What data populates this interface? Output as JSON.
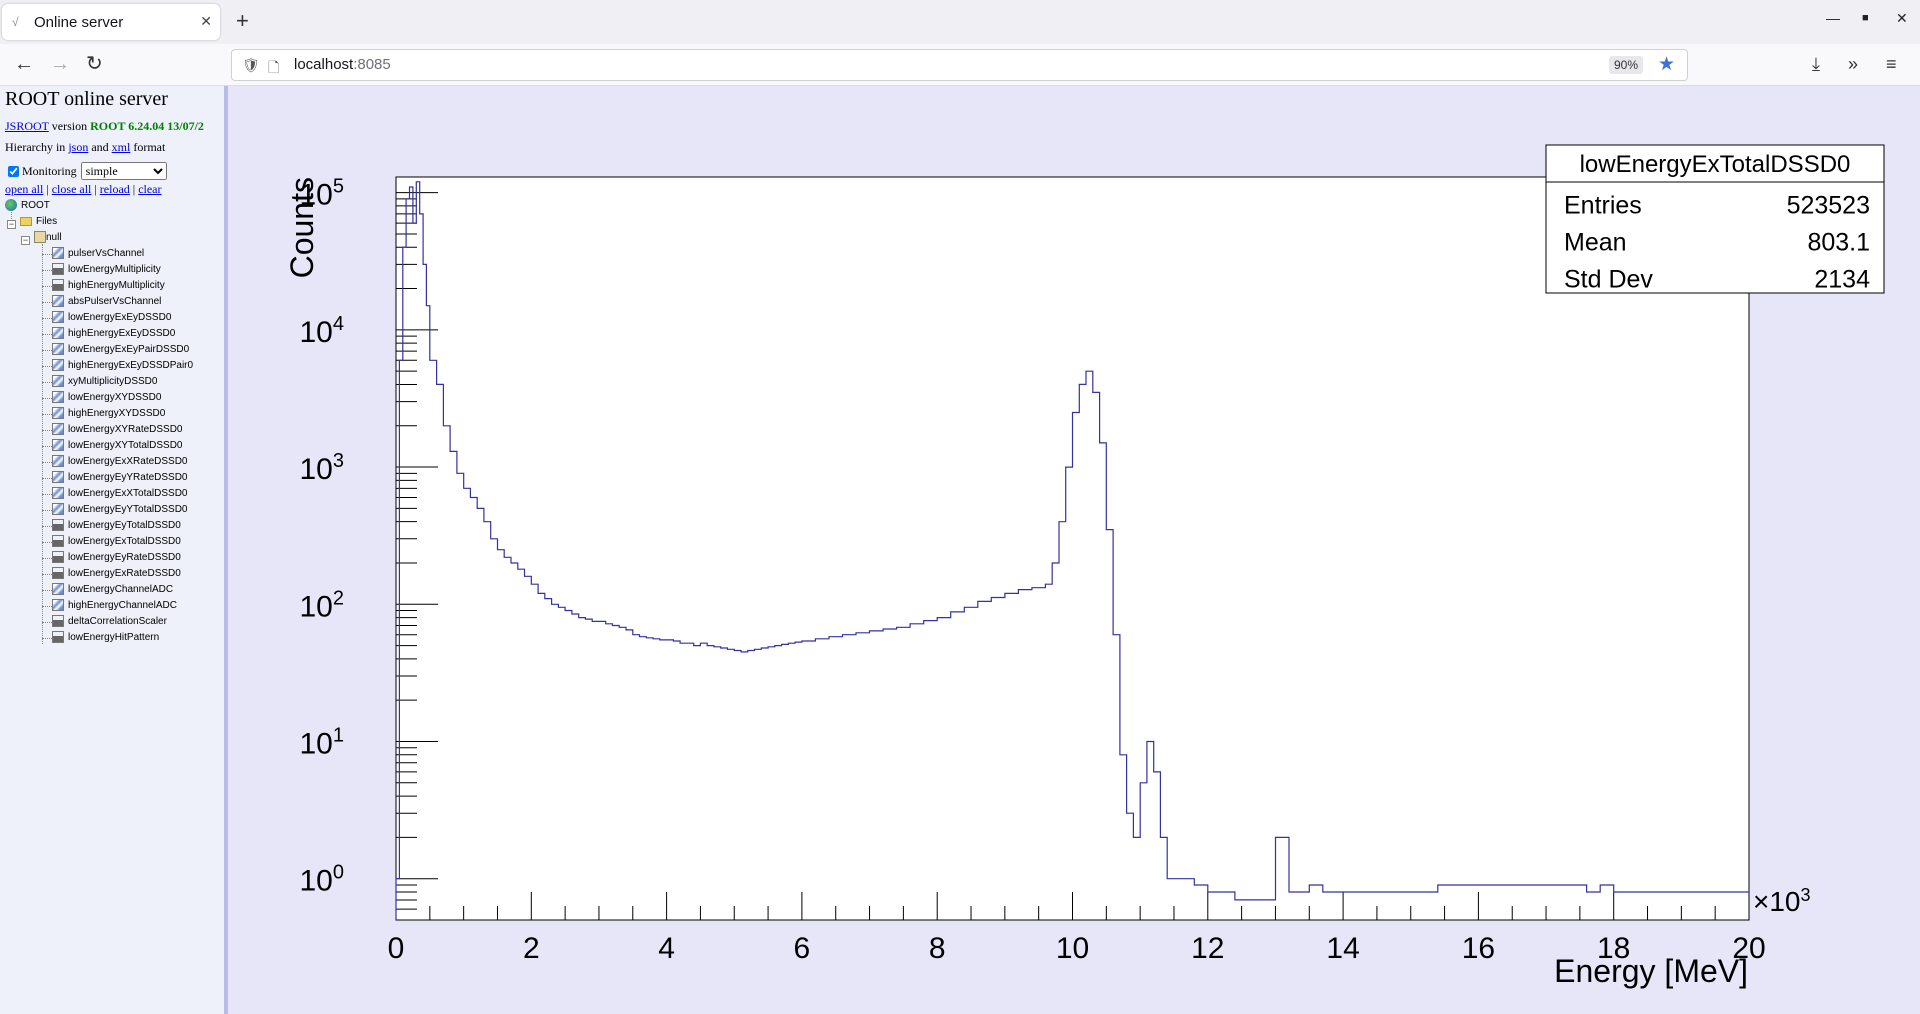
{
  "browser": {
    "tab_title": "Online server",
    "url_host": "localhost",
    "url_port": ":8085",
    "zoom": "90%"
  },
  "sidebar": {
    "title": "ROOT online server",
    "jsroot_link": "JSROOT",
    "version_word": "version",
    "version_value": "ROOT 6.24.04 13/07/2",
    "hierarchy_prefix": "Hierarchy in",
    "json_link": "json",
    "and_word": "and",
    "xml_link": "xml",
    "format_word": "format",
    "monitoring_label": "Monitoring",
    "monitoring_checked": true,
    "monitoring_mode": "simple",
    "actions": [
      "open all",
      "close all",
      "reload",
      "clear"
    ],
    "tree": {
      "root": "ROOT",
      "files": "Files",
      "null": "null",
      "items": [
        {
          "label": "pulserVsChannel",
          "icon": "h2-icon"
        },
        {
          "label": "lowEnergyMultiplicity",
          "icon": "h1-icon"
        },
        {
          "label": "highEnergyMultiplicity",
          "icon": "h1-icon"
        },
        {
          "label": "absPulserVsChannel",
          "icon": "h2-icon"
        },
        {
          "label": "lowEnergyExEyDSSD0",
          "icon": "h2-icon"
        },
        {
          "label": "highEnergyExEyDSSD0",
          "icon": "h2-icon"
        },
        {
          "label": "lowEnergyExEyPairDSSD0",
          "icon": "h2-icon"
        },
        {
          "label": "highEnergyExEyDSSDPair0",
          "icon": "h2-icon"
        },
        {
          "label": "xyMultiplicityDSSD0",
          "icon": "h2-icon"
        },
        {
          "label": "lowEnergyXYDSSD0",
          "icon": "h2-icon"
        },
        {
          "label": "highEnergyXYDSSD0",
          "icon": "h2-icon"
        },
        {
          "label": "lowEnergyXYRateDSSD0",
          "icon": "h2-icon"
        },
        {
          "label": "lowEnergyXYTotalDSSD0",
          "icon": "h2-icon"
        },
        {
          "label": "lowEnergyExXRateDSSD0",
          "icon": "h2-icon"
        },
        {
          "label": "lowEnergyEyYRateDSSD0",
          "icon": "h2-icon"
        },
        {
          "label": "lowEnergyExXTotalDSSD0",
          "icon": "h2-icon"
        },
        {
          "label": "lowEnergyEyYTotalDSSD0",
          "icon": "h2-icon"
        },
        {
          "label": "lowEnergyEyTotalDSSD0",
          "icon": "h1-icon"
        },
        {
          "label": "lowEnergyExTotalDSSD0",
          "icon": "h1-icon"
        },
        {
          "label": "lowEnergyEyRateDSSD0",
          "icon": "h1-icon"
        },
        {
          "label": "lowEnergyExRateDSSD0",
          "icon": "h1-icon"
        },
        {
          "label": "lowEnergyChannelADC",
          "icon": "h2-icon"
        },
        {
          "label": "highEnergyChannelADC",
          "icon": "h2-icon"
        },
        {
          "label": "deltaCorrelationScaler",
          "icon": "h1-icon"
        },
        {
          "label": "lowEnergyHitPattern",
          "icon": "h1-icon"
        }
      ]
    }
  },
  "stats": {
    "name": "lowEnergyExTotalDSSD0",
    "rows": [
      {
        "label": "Entries",
        "value": "523523"
      },
      {
        "label": "Mean",
        "value": "803.1"
      },
      {
        "label": "Std Dev",
        "value": "2134"
      }
    ]
  },
  "chart_data": {
    "type": "line",
    "title": "",
    "xlabel": "Energy [MeV]",
    "ylabel": "Counts",
    "x_exponent_label": "×10^3",
    "xlim": [
      0,
      20000
    ],
    "ylim": [
      0.5,
      130000
    ],
    "yscale": "log",
    "line_color": "#3232a0",
    "background": "#e6e6f8",
    "xticks": [
      {
        "value": 0,
        "label": "0"
      },
      {
        "value": 2000,
        "label": "2"
      },
      {
        "value": 4000,
        "label": "4"
      },
      {
        "value": 6000,
        "label": "6"
      },
      {
        "value": 8000,
        "label": "8"
      },
      {
        "value": 10000,
        "label": "10"
      },
      {
        "value": 12000,
        "label": "12"
      },
      {
        "value": 14000,
        "label": "14"
      },
      {
        "value": 16000,
        "label": "16"
      },
      {
        "value": 18000,
        "label": "18"
      },
      {
        "value": 20000,
        "label": "20"
      }
    ],
    "yticks": [
      {
        "value": 1,
        "base": "10",
        "exp": "0"
      },
      {
        "value": 10,
        "base": "10",
        "exp": "1"
      },
      {
        "value": 100,
        "base": "10",
        "exp": "2"
      },
      {
        "value": 1000,
        "base": "10",
        "exp": "3"
      },
      {
        "value": 10000,
        "base": "10",
        "exp": "4"
      },
      {
        "value": 100000,
        "base": "10",
        "exp": "5"
      }
    ],
    "series": [
      {
        "points": [
          [
            0,
            1
          ],
          [
            50,
            6000
          ],
          [
            100,
            40000
          ],
          [
            150,
            90000
          ],
          [
            200,
            110000
          ],
          [
            250,
            60000
          ],
          [
            300,
            120000
          ],
          [
            350,
            70000
          ],
          [
            400,
            30000
          ],
          [
            450,
            15000
          ],
          [
            500,
            6000
          ],
          [
            600,
            4000
          ],
          [
            700,
            2000
          ],
          [
            800,
            1300
          ],
          [
            900,
            900
          ],
          [
            1000,
            700
          ],
          [
            1100,
            600
          ],
          [
            1200,
            500
          ],
          [
            1300,
            400
          ],
          [
            1400,
            300
          ],
          [
            1500,
            250
          ],
          [
            1600,
            220
          ],
          [
            1700,
            200
          ],
          [
            1800,
            180
          ],
          [
            1900,
            160
          ],
          [
            2000,
            140
          ],
          [
            2100,
            120
          ],
          [
            2200,
            110
          ],
          [
            2300,
            100
          ],
          [
            2400,
            95
          ],
          [
            2500,
            90
          ],
          [
            2600,
            85
          ],
          [
            2700,
            80
          ],
          [
            2800,
            78
          ],
          [
            2900,
            75
          ],
          [
            3000,
            75
          ],
          [
            3100,
            72
          ],
          [
            3200,
            70
          ],
          [
            3300,
            68
          ],
          [
            3400,
            65
          ],
          [
            3500,
            60
          ],
          [
            3600,
            58
          ],
          [
            3700,
            57
          ],
          [
            3800,
            56
          ],
          [
            3900,
            55
          ],
          [
            4000,
            55
          ],
          [
            4100,
            54
          ],
          [
            4200,
            52
          ],
          [
            4300,
            52
          ],
          [
            4400,
            50
          ],
          [
            4500,
            52
          ],
          [
            4600,
            50
          ],
          [
            4700,
            49
          ],
          [
            4800,
            48
          ],
          [
            4900,
            47
          ],
          [
            5000,
            46
          ],
          [
            5100,
            45
          ],
          [
            5200,
            46
          ],
          [
            5300,
            47
          ],
          [
            5400,
            48
          ],
          [
            5500,
            49
          ],
          [
            5600,
            50
          ],
          [
            5700,
            51
          ],
          [
            5800,
            52
          ],
          [
            5900,
            53
          ],
          [
            6000,
            54
          ],
          [
            6200,
            56
          ],
          [
            6400,
            58
          ],
          [
            6600,
            60
          ],
          [
            6800,
            62
          ],
          [
            7000,
            64
          ],
          [
            7200,
            66
          ],
          [
            7400,
            68
          ],
          [
            7600,
            72
          ],
          [
            7800,
            76
          ],
          [
            8000,
            80
          ],
          [
            8200,
            88
          ],
          [
            8400,
            95
          ],
          [
            8600,
            105
          ],
          [
            8800,
            112
          ],
          [
            9000,
            120
          ],
          [
            9200,
            128
          ],
          [
            9400,
            132
          ],
          [
            9600,
            140
          ],
          [
            9700,
            200
          ],
          [
            9800,
            400
          ],
          [
            9900,
            1000
          ],
          [
            10000,
            2500
          ],
          [
            10100,
            4000
          ],
          [
            10200,
            5000
          ],
          [
            10300,
            3500
          ],
          [
            10400,
            1500
          ],
          [
            10500,
            350
          ],
          [
            10600,
            60
          ],
          [
            10700,
            8
          ],
          [
            10800,
            3
          ],
          [
            10900,
            2
          ],
          [
            11000,
            5
          ],
          [
            11100,
            10
          ],
          [
            11200,
            6
          ],
          [
            11300,
            2
          ],
          [
            11400,
            1
          ],
          [
            11500,
            1
          ],
          [
            11800,
            0.9
          ],
          [
            12000,
            0.8
          ],
          [
            12200,
            0.8
          ],
          [
            12400,
            0.7
          ],
          [
            12600,
            0.7
          ],
          [
            12800,
            0.7
          ],
          [
            13000,
            2
          ],
          [
            13200,
            0.8
          ],
          [
            13500,
            0.9
          ],
          [
            13700,
            0.8
          ],
          [
            15200,
            0.8
          ],
          [
            15400,
            0.9
          ],
          [
            17600,
            0.8
          ],
          [
            17800,
            0.9
          ],
          [
            18000,
            0.8
          ],
          [
            20000,
            0.8
          ]
        ]
      }
    ]
  }
}
